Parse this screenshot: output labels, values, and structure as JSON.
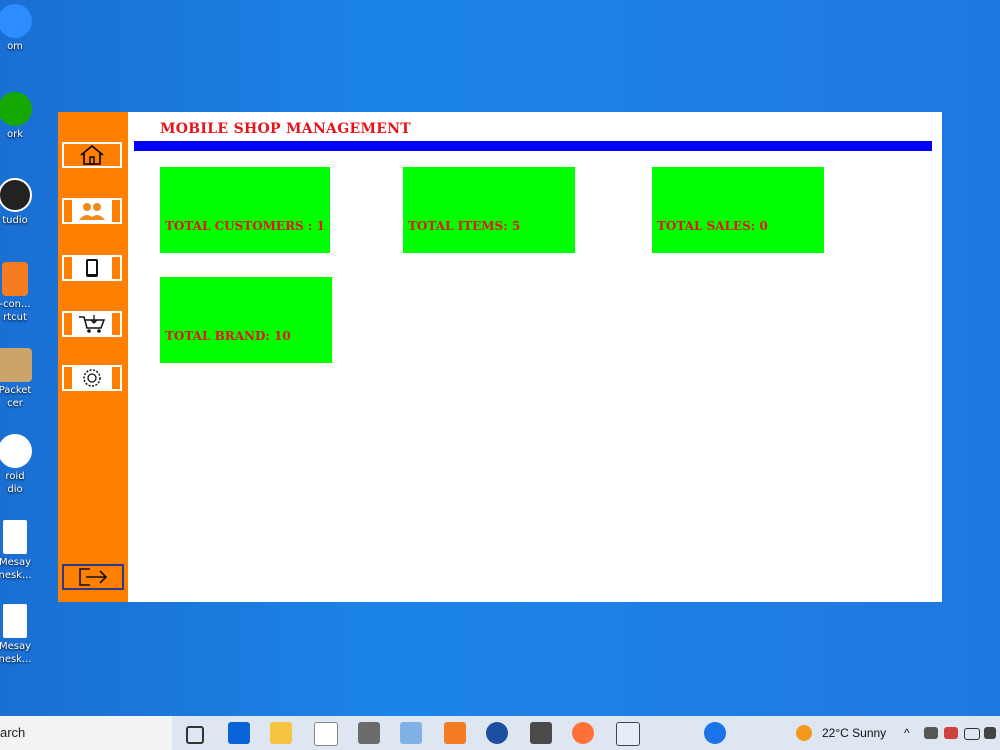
{
  "desktop": {
    "icons": [
      {
        "label": "om",
        "color": "#2d8cff"
      },
      {
        "label": "ork",
        "color": "#14a800"
      },
      {
        "label": "tudio",
        "color": "#222222"
      },
      {
        "label": "-con...\nrtcut",
        "color": "#f57c20"
      },
      {
        "label": "Packet\ncer",
        "color": "#caa46a"
      },
      {
        "label": "roid\ndio",
        "color": "#3ddc84"
      },
      {
        "label": "Mesay\nnesk...",
        "color": "#ffffff"
      },
      {
        "label": "Mesay\nnesk...",
        "color": "#ffffff"
      }
    ]
  },
  "app": {
    "title": "MOBILE SHOP MANAGEMENT",
    "sidebar": [
      {
        "icon": "home-icon"
      },
      {
        "icon": "customers-icon"
      },
      {
        "icon": "mobile-icon"
      },
      {
        "icon": "cart-icon"
      },
      {
        "icon": "settings-icon"
      }
    ],
    "logout_icon": "logout-icon",
    "cards": {
      "customers": "TOTAL CUSTOMERS : 1",
      "items": "TOTAL ITEMS:  5",
      "sales": "TOTAL SALES:  0",
      "brand": "TOTAL BRAND:   10"
    },
    "colors": {
      "sidebar": "#ff8000",
      "card": "#00ff00",
      "card_text": "#e8121a",
      "title_bar": "#0000ff"
    }
  },
  "taskbar": {
    "search_text": "arch",
    "weather": "22°C  Sunny"
  }
}
